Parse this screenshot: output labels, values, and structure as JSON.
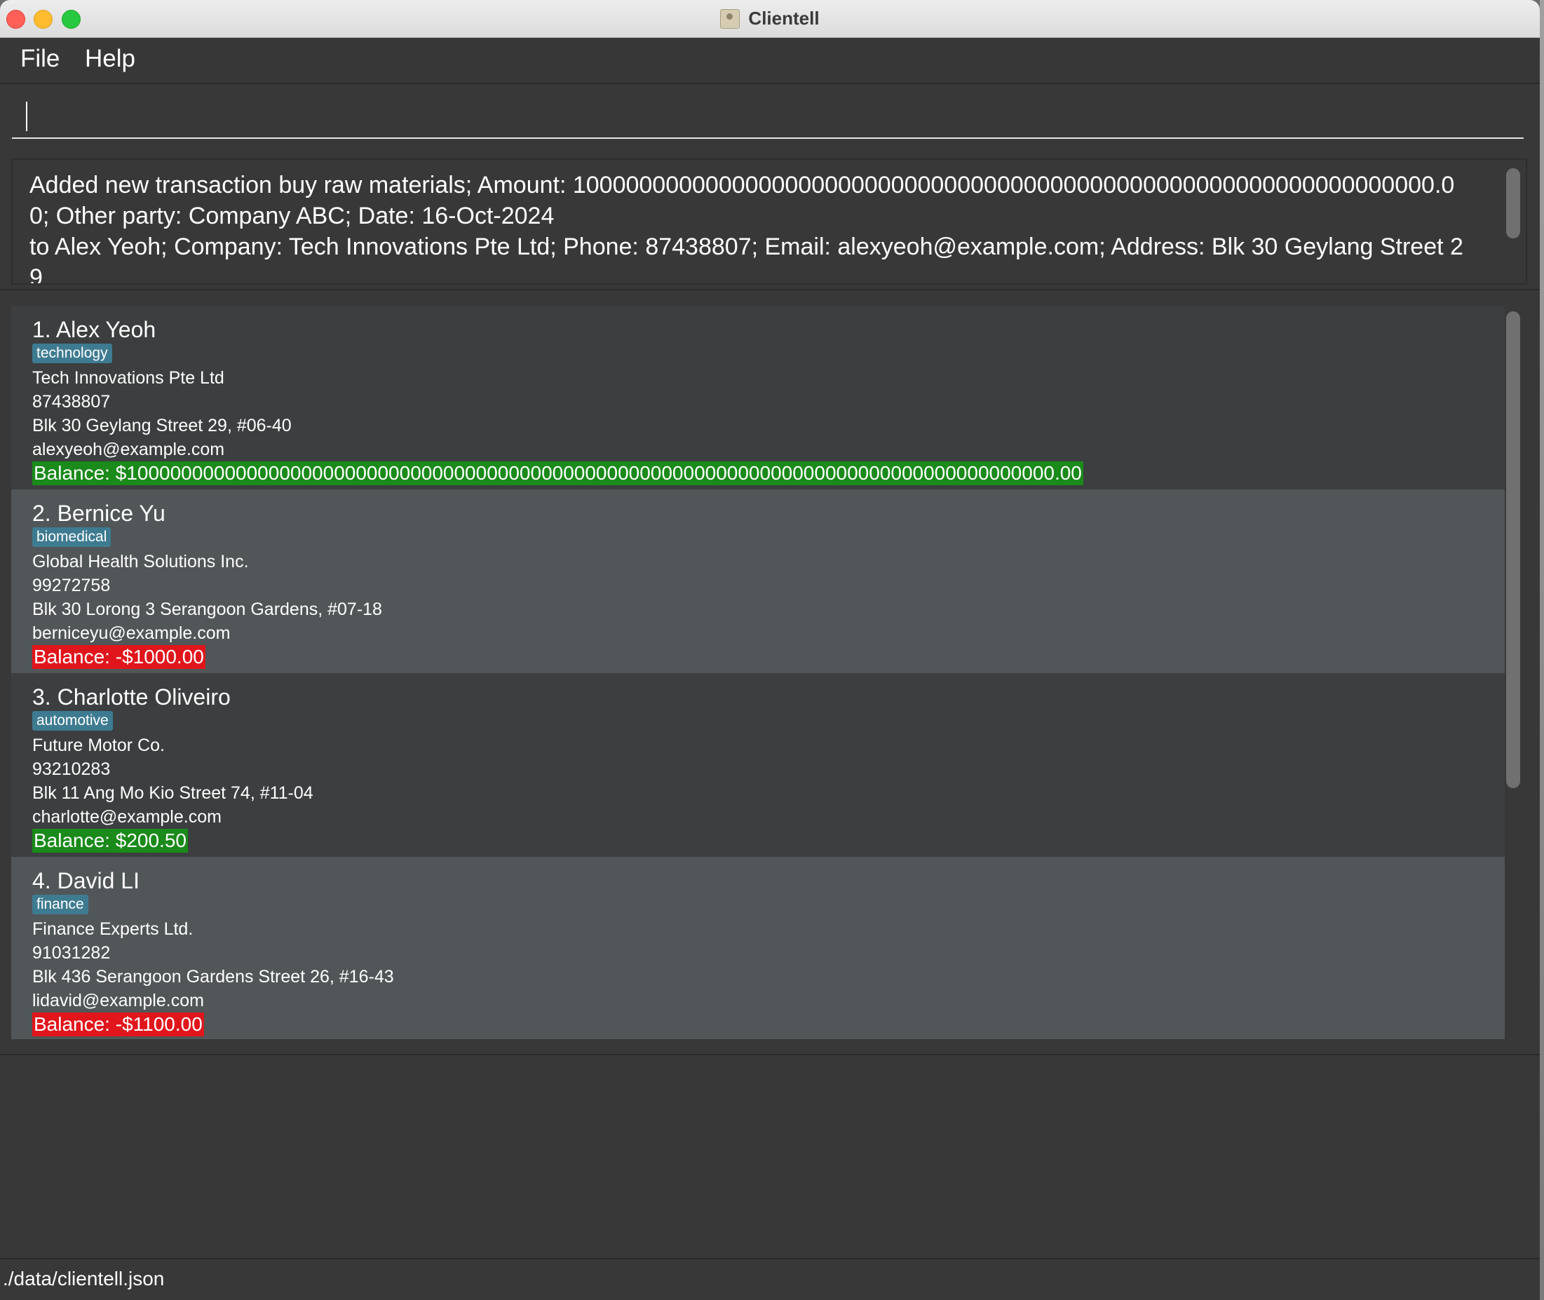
{
  "window": {
    "title": "Clientell"
  },
  "menu": {
    "file": "File",
    "help": "Help"
  },
  "command": {
    "value": "",
    "placeholder": ""
  },
  "result": {
    "text": "Added new transaction buy raw materials; Amount: 10000000000000000000000000000000000000000000000000000000000000000.00; Other party: Company ABC; Date: 16-Oct-2024\nto Alex Yeoh; Company: Tech Innovations Pte Ltd; Phone: 87438807; Email: alexyeoh@example.com; Address: Blk 30 Geylang Street 29"
  },
  "clients": [
    {
      "index_name": "1. Alex Yeoh",
      "tag": "technology",
      "company": "Tech Innovations Pte Ltd",
      "phone": "87438807",
      "address": "Blk 30 Geylang Street 29, #06-40",
      "email": "alexyeoh@example.com",
      "balance": "Balance: $1000000000000000000000000000000000000000000000000000000000000000000000000000000000000.00",
      "balance_status": "positive"
    },
    {
      "index_name": "2. Bernice Yu",
      "tag": "biomedical",
      "company": "Global Health Solutions Inc.",
      "phone": "99272758",
      "address": "Blk 30 Lorong 3 Serangoon Gardens, #07-18",
      "email": "berniceyu@example.com",
      "balance": "Balance: -$1000.00",
      "balance_status": "negative"
    },
    {
      "index_name": "3. Charlotte Oliveiro",
      "tag": "automotive",
      "company": "Future Motor Co.",
      "phone": "93210283",
      "address": "Blk 11 Ang Mo Kio Street 74, #11-04",
      "email": "charlotte@example.com",
      "balance": "Balance: $200.50",
      "balance_status": "positive"
    },
    {
      "index_name": "4. David LI",
      "tag": "finance",
      "company": "Finance Experts Ltd.",
      "phone": "91031282",
      "address": "Blk 436 Serangoon Gardens Street 26, #16-43",
      "email": "lidavid@example.com",
      "balance": "Balance: -$1100.00",
      "balance_status": "negative"
    }
  ],
  "status_bar": {
    "path": "./data/clientell.json"
  },
  "colors": {
    "positive_balance": "#1a8a1a",
    "negative_balance": "#e0161c",
    "tag": "#3e7b91"
  }
}
